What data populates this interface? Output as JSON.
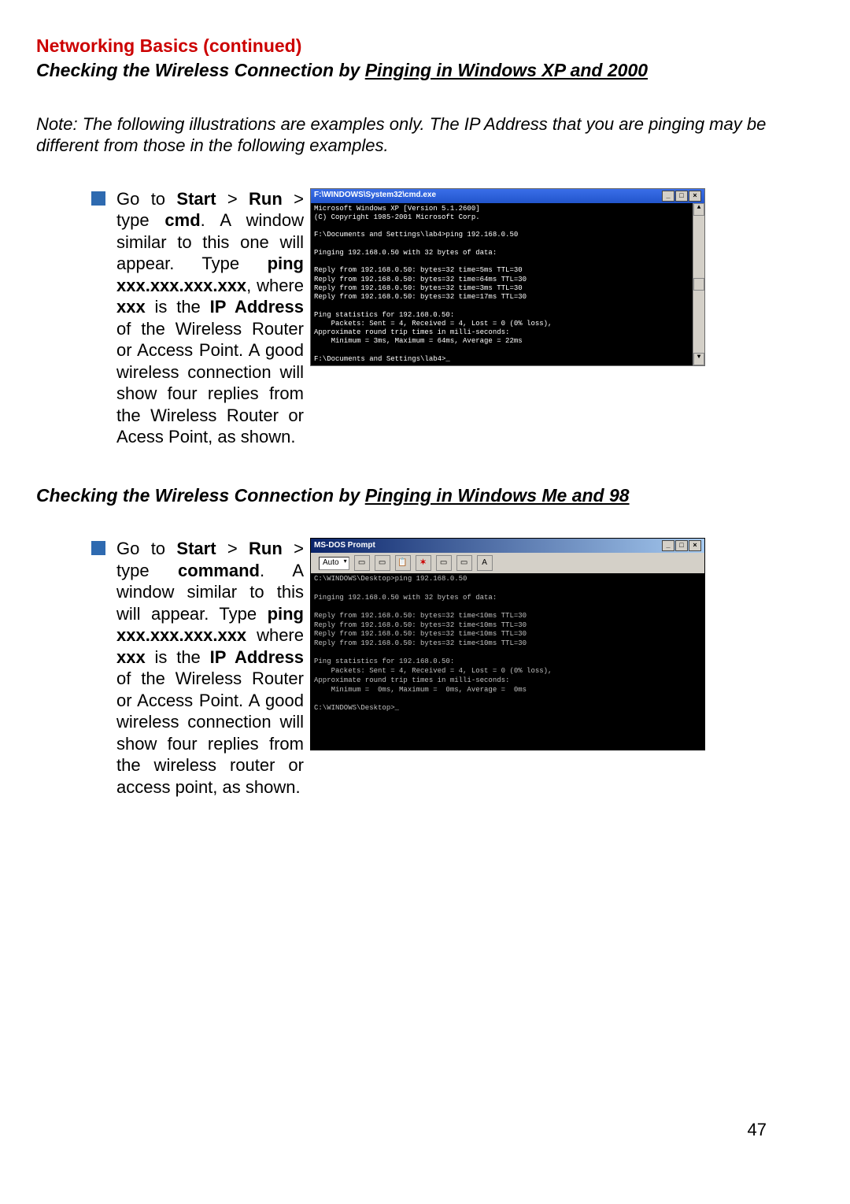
{
  "heading": "Networking Basics (continued)",
  "sub1_a": "Checking the Wireless Connection by ",
  "sub1_u": "Pinging in Windows XP and 2000",
  "note": "Note: The following illustrations are examples only. The IP Address that you are pinging may be different from those in the following examples.",
  "bullet1": {
    "t1": "Go to ",
    "b1": "Start",
    "t2": " > ",
    "b2": "Run",
    "t3": " > type ",
    "b3": "cmd",
    "t4": ". A window similar to this one will appear. Type ",
    "b4": "ping xxx.xxx.xxx.xxx",
    "t5": ", where ",
    "b5": "xxx",
    "t6": " is the ",
    "b6": "IP Address",
    "t7": " of the Wireless Router or Access Point. A good wireless connection will show four replies from the Wireless Router or Acess Point, as shown."
  },
  "cmd_title": "F:\\WINDOWS\\System32\\cmd.exe",
  "cmd_lines": "Microsoft Windows XP [Version 5.1.2600]\n(C) Copyright 1985-2001 Microsoft Corp.\n\nF:\\Documents and Settings\\lab4>ping 192.168.0.50\n\nPinging 192.168.0.50 with 32 bytes of data:\n\nReply from 192.168.0.50: bytes=32 time=5ms TTL=30\nReply from 192.168.0.50: bytes=32 time=64ms TTL=30\nReply from 192.168.0.50: bytes=32 time=3ms TTL=30\nReply from 192.168.0.50: bytes=32 time=17ms TTL=30\n\nPing statistics for 192.168.0.50:\n    Packets: Sent = 4, Received = 4, Lost = 0 (0% loss),\nApproximate round trip times in milli-seconds:\n    Minimum = 3ms, Maximum = 64ms, Average = 22ms\n\nF:\\Documents and Settings\\lab4>_",
  "sub2_a": "Checking the Wireless Connection by ",
  "sub2_u": "Pinging in Windows Me and 98",
  "bullet2": {
    "t1": "Go to ",
    "b1": "Start",
    "t2": " > ",
    "b2": "Run",
    "t3": " > type ",
    "b3": "command",
    "t4": ". A window similar to this will appear. Type ",
    "b4": "ping xxx.xxx.xxx.xxx",
    "t5": " where ",
    "b5": "xxx",
    "t6": " is the ",
    "b6": "IP Address",
    "t7": " of the Wireless Router or Access Point. A good wireless connection will show four replies from the wireless router or access point, as shown."
  },
  "dos_title": "MS-DOS Prompt",
  "dos_auto": "Auto",
  "dos_tb_A": "A",
  "dos_lines": "C:\\WINDOWS\\Desktop>ping 192.168.0.50\n\nPinging 192.168.0.50 with 32 bytes of data:\n\nReply from 192.168.0.50: bytes=32 time<10ms TTL=30\nReply from 192.168.0.50: bytes=32 time<10ms TTL=30\nReply from 192.168.0.50: bytes=32 time<10ms TTL=30\nReply from 192.168.0.50: bytes=32 time<10ms TTL=30\n\nPing statistics for 192.168.0.50:\n    Packets: Sent = 4, Received = 4, Lost = 0 (0% loss),\nApproximate round trip times in milli-seconds:\n    Minimum =  0ms, Maximum =  0ms, Average =  0ms\n\nC:\\WINDOWS\\Desktop>_",
  "page_num": "47",
  "btn_min": "_",
  "btn_max": "□",
  "btn_close": "×",
  "scroll_up": "▲",
  "scroll_dn": "▼"
}
